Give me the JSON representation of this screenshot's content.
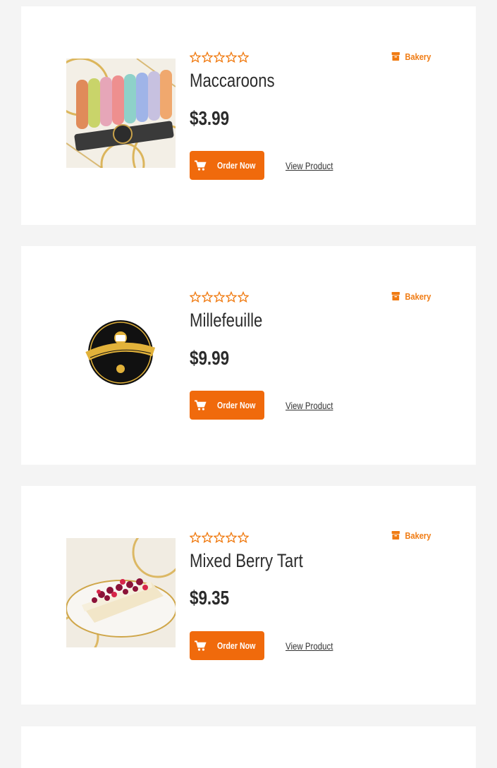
{
  "colors": {
    "accent": "#f06a0c",
    "category_text": "#f07b12",
    "star_outline": "#f07b12",
    "card_bg": "#ffffff",
    "page_bg": "#f4f4f4"
  },
  "products": [
    {
      "name": "Maccaroons",
      "price": "$3.99",
      "category": "Bakery",
      "rating": 0,
      "order_label": "Order Now",
      "view_label": "View Product",
      "image": "macarons-photo"
    },
    {
      "name": "Millefeuille",
      "price": "$9.99",
      "category": "Bakery",
      "rating": 0,
      "order_label": "Order Now",
      "view_label": "View Product",
      "image": "cafe-logo"
    },
    {
      "name": "Mixed Berry Tart",
      "price": "$9.35",
      "category": "Bakery",
      "rating": 0,
      "order_label": "Order Now",
      "view_label": "View Product",
      "image": "berry-tart-photo"
    }
  ]
}
